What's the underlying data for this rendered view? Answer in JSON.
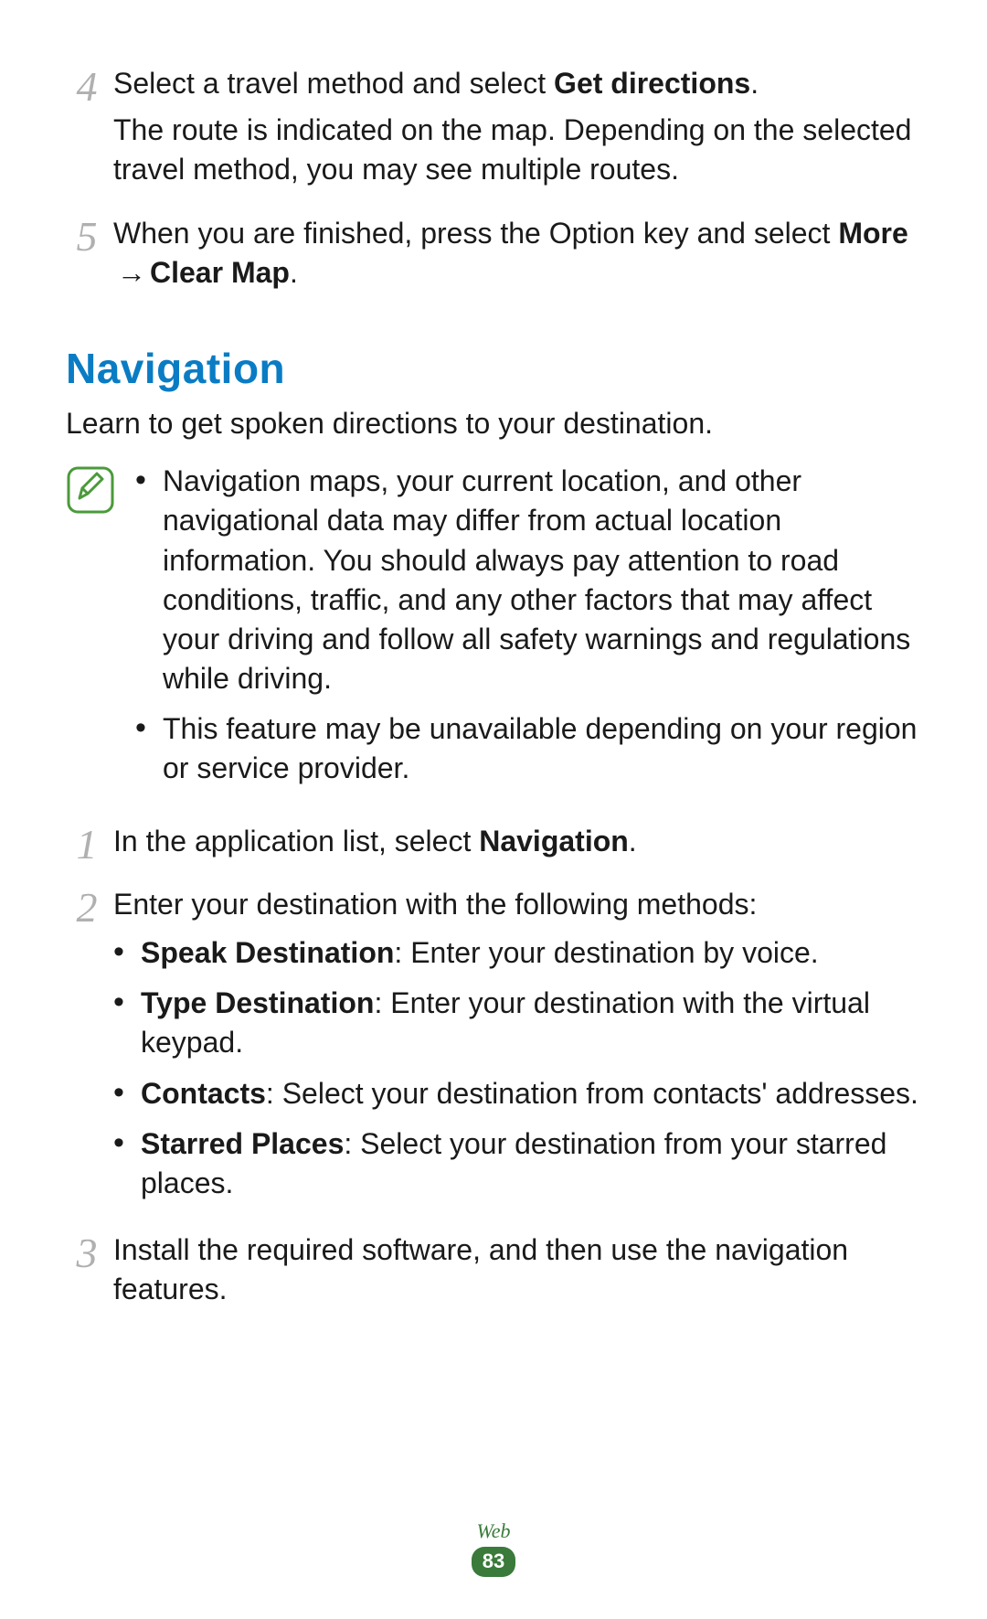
{
  "top_steps": [
    {
      "num": "4",
      "lines": [
        [
          {
            "t": "Select a travel method and select "
          },
          {
            "t": "Get directions",
            "b": true
          },
          {
            "t": "."
          }
        ],
        [
          {
            "t": "The route is indicated on the map. Depending on the selected travel method, you may see multiple routes."
          }
        ]
      ]
    },
    {
      "num": "5",
      "lines": [
        [
          {
            "t": "When you are finished, press the Option key and select "
          },
          {
            "t": "More",
            "b": true
          },
          {
            "t": " → ",
            "arrow": true
          },
          {
            "t": "Clear Map",
            "b": true
          },
          {
            "t": "."
          }
        ]
      ]
    }
  ],
  "heading": "Navigation",
  "intro": "Learn to get spoken directions to your destination.",
  "note_bullets": [
    "Navigation maps, your current location, and other navigational data may differ from actual location information. You should always pay attention to road conditions, traffic, and any other factors that may affect your driving and follow all safety warnings and regulations while driving.",
    "This feature may be unavailable depending on your region or service provider."
  ],
  "nav_steps": [
    {
      "num": "1",
      "lines": [
        [
          {
            "t": "In the application list, select "
          },
          {
            "t": "Navigation",
            "b": true
          },
          {
            "t": "."
          }
        ]
      ]
    },
    {
      "num": "2",
      "lines": [
        [
          {
            "t": "Enter your destination with the following methods:"
          }
        ]
      ],
      "sub": [
        [
          {
            "t": "Speak Destination",
            "b": true
          },
          {
            "t": ": Enter your destination by voice."
          }
        ],
        [
          {
            "t": "Type Destination",
            "b": true
          },
          {
            "t": ": Enter your destination with the virtual keypad."
          }
        ],
        [
          {
            "t": "Contacts",
            "b": true
          },
          {
            "t": ": Select your destination from contacts' addresses."
          }
        ],
        [
          {
            "t": "Starred Places",
            "b": true
          },
          {
            "t": ": Select your destination from your starred places."
          }
        ]
      ]
    },
    {
      "num": "3",
      "lines": [
        [
          {
            "t": "Install the required software, and then use the navigation features."
          }
        ]
      ]
    }
  ],
  "footer": {
    "section": "Web",
    "page": "83"
  }
}
